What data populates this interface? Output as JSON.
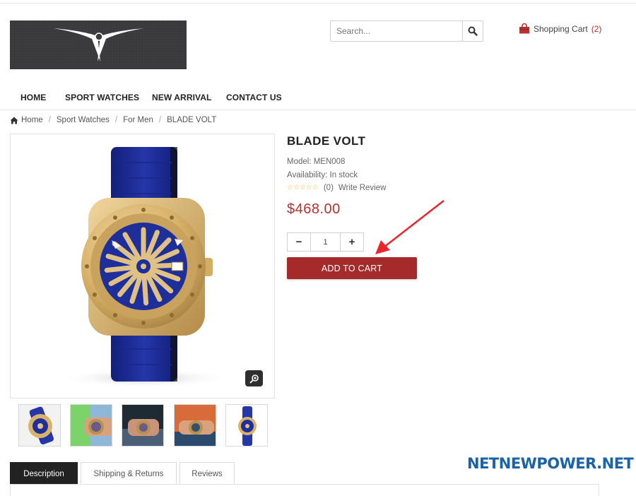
{
  "header": {
    "logo_icon": "winged-v-logo-icon",
    "search": {
      "placeholder": "Search...",
      "icon": "search-icon"
    },
    "cart": {
      "label": "Shopping Cart",
      "count": "(2)",
      "icon": "shopping-bag-icon"
    }
  },
  "nav": {
    "items": [
      {
        "label": "HOME"
      },
      {
        "label": "SPORT WATCHES"
      },
      {
        "label": "NEW ARRIVAL"
      },
      {
        "label": "CONTACT US"
      }
    ]
  },
  "breadcrumb": {
    "items": [
      {
        "label": "Home",
        "icon": "home-icon"
      },
      {
        "label": "Sport Watches"
      },
      {
        "label": "For Men"
      },
      {
        "label": "BLADE VOLT"
      }
    ]
  },
  "product": {
    "title": "BLADE VOLT",
    "model": "Model: MEN008",
    "availability": "Availability: In stock",
    "rating": {
      "stars": 5,
      "filled": 0,
      "count": "(0)",
      "write_review": "Write Review"
    },
    "price": "$468.00",
    "quantity": "1",
    "qty_minus": "−",
    "qty_plus": "+",
    "add_to_cart": "ADD TO CART"
  },
  "tabs": [
    {
      "label": "Description",
      "active": true
    },
    {
      "label": "Shipping & Returns",
      "active": false
    },
    {
      "label": "Reviews",
      "active": false
    }
  ],
  "watermark": "NETNEWPOWER.NET",
  "colors": {
    "accent_red": "#b8312f",
    "button_red": "#a52a2a",
    "watch_blue": "#1f2f9a",
    "watch_gold": "#d9b36a",
    "watermark_blue": "#1a63a8"
  }
}
